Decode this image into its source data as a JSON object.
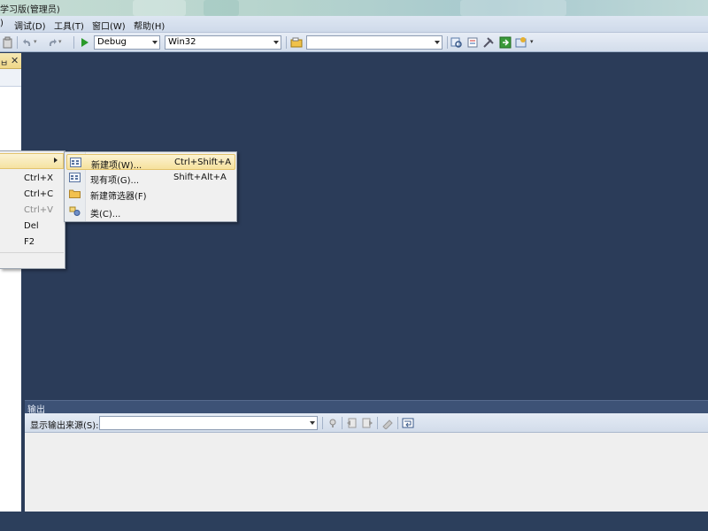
{
  "window": {
    "title": "学习版(管理员)"
  },
  "menubar": [
    {
      "label": ")"
    },
    {
      "label": "调试(D)"
    },
    {
      "label": "工具(T)"
    },
    {
      "label": "窗口(W)"
    },
    {
      "label": "帮助(H)"
    }
  ],
  "toolbar": {
    "config": "Debug",
    "platform": "Win32",
    "find": ""
  },
  "context_menu": {
    "shortcuts": [
      {
        "label": "Ctrl+X",
        "enabled": true
      },
      {
        "label": "Ctrl+C",
        "enabled": true
      },
      {
        "label": "Ctrl+V",
        "enabled": false
      },
      {
        "label": "Del",
        "enabled": true
      },
      {
        "label": "F2",
        "enabled": true
      }
    ]
  },
  "submenu": [
    {
      "label": "新建项(W)...",
      "shortcut": "Ctrl+Shift+A",
      "icon": "new-item-icon"
    },
    {
      "label": "现有项(G)...",
      "shortcut": "Shift+Alt+A",
      "icon": "existing-item-icon"
    },
    {
      "label": "新建筛选器(F)",
      "shortcut": "",
      "icon": "folder-icon"
    },
    {
      "label": "类(C)...",
      "shortcut": "",
      "icon": "class-icon"
    }
  ],
  "output": {
    "title": "输出",
    "source_label": "显示输出来源(S):",
    "source_value": ""
  }
}
